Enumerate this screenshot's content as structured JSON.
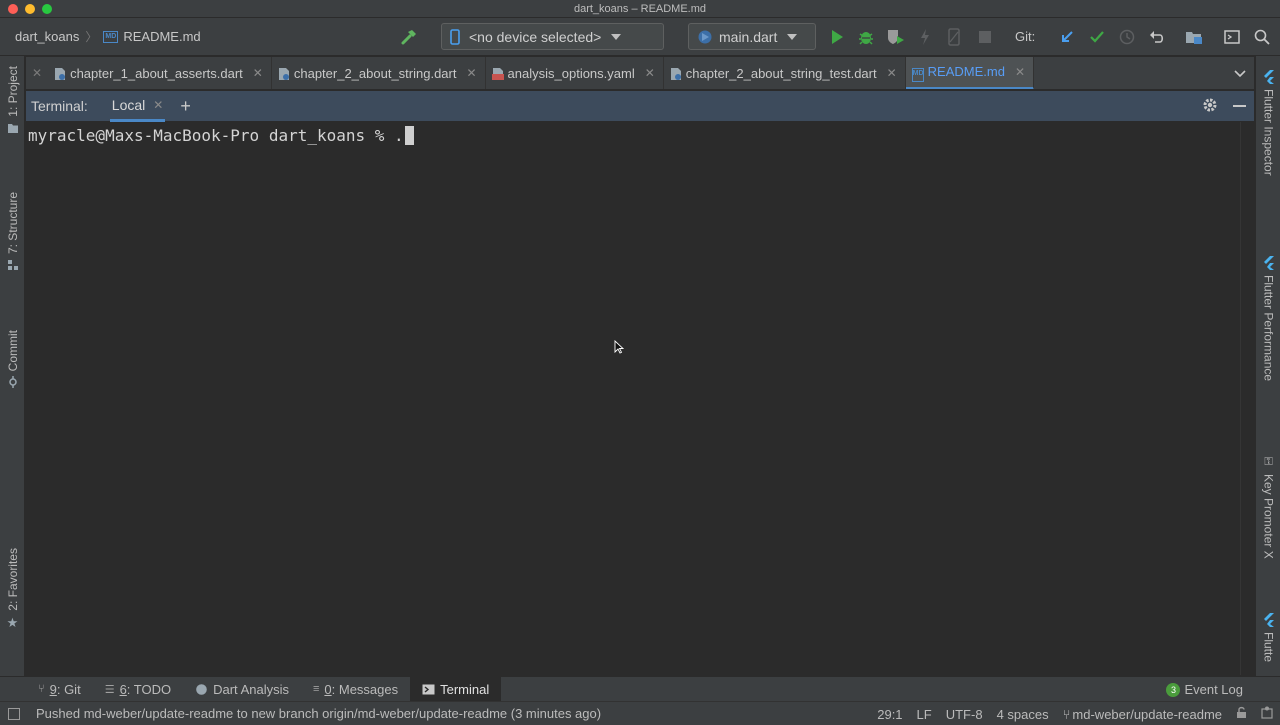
{
  "window": {
    "title": "dart_koans – README.md"
  },
  "breadcrumb": {
    "project": "dart_koans",
    "file": "README.md",
    "file_icon": "MD"
  },
  "toolbar": {
    "device_selector": "<no device selected>",
    "run_config": "main.dart",
    "git_label": "Git:"
  },
  "left_tool_tabs": [
    {
      "label": "1: Project"
    },
    {
      "label": "7: Structure"
    },
    {
      "label": "Commit"
    },
    {
      "label": "2: Favorites"
    }
  ],
  "right_tool_tabs": [
    {
      "label": "Flutter Inspector"
    },
    {
      "label": "Flutter Performance"
    },
    {
      "label": "Key Promoter X"
    },
    {
      "label": "Flutte"
    }
  ],
  "editor_tabs": [
    {
      "label": "chapter_1_about_asserts.dart",
      "icon": "dart-file-icon"
    },
    {
      "label": "chapter_2_about_string.dart",
      "icon": "dart-file-icon"
    },
    {
      "label": "analysis_options.yaml",
      "icon": "yaml-file-icon"
    },
    {
      "label": "chapter_2_about_string_test.dart",
      "icon": "dart-test-file-icon"
    },
    {
      "label": "README.md",
      "icon": "markdown-file-icon",
      "active": true
    }
  ],
  "terminal": {
    "title": "Terminal:",
    "tab_label": "Local",
    "prompt": "myracle@Maxs-MacBook-Pro dart_koans % ."
  },
  "bottom_tools": [
    {
      "number": "9",
      "label": ": Git"
    },
    {
      "number": "6",
      "label": ": TODO"
    },
    {
      "number": "",
      "label": "Dart Analysis"
    },
    {
      "number": "0",
      "label": ": Messages"
    },
    {
      "number": "",
      "label": "Terminal"
    }
  ],
  "event_log": {
    "count": "3",
    "label": "Event Log"
  },
  "status": {
    "message": "Pushed md-weber/update-readme to new branch origin/md-weber/update-readme (3 minutes ago)",
    "position": "29:1",
    "line_ending": "LF",
    "encoding": "UTF-8",
    "indent": "4 spaces",
    "branch": "md-weber/update-readme"
  },
  "colors": {
    "accent": "#4a88c7",
    "run_green": "#3fa845",
    "terminal_header": "#3d4b5c",
    "background": "#2b2b2b"
  }
}
